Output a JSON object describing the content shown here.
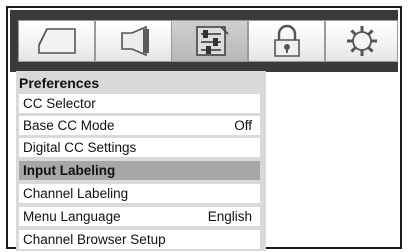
{
  "tabs": [
    {
      "icon": "picture-icon",
      "active": false
    },
    {
      "icon": "sound-icon",
      "active": false
    },
    {
      "icon": "setup-icon",
      "active": true
    },
    {
      "icon": "lock-icon",
      "active": false
    },
    {
      "icon": "settings-gear-icon",
      "active": false
    }
  ],
  "menu": {
    "title": "Preferences",
    "items": [
      {
        "label": "CC Selector",
        "value": ""
      },
      {
        "label": "Base CC Mode",
        "value": "Off"
      },
      {
        "label": "Digital CC Settings",
        "value": ""
      },
      {
        "label": "Input Labeling",
        "value": "",
        "selected": true
      },
      {
        "label": "Channel Labeling",
        "value": ""
      },
      {
        "label": "Menu Language",
        "value": "English"
      },
      {
        "label": "Channel Browser Setup",
        "value": ""
      }
    ]
  },
  "colors": {
    "tabbar": "#3a3a3a",
    "panel": "#d9d9d9",
    "selected_row": "#a7a7a7"
  }
}
